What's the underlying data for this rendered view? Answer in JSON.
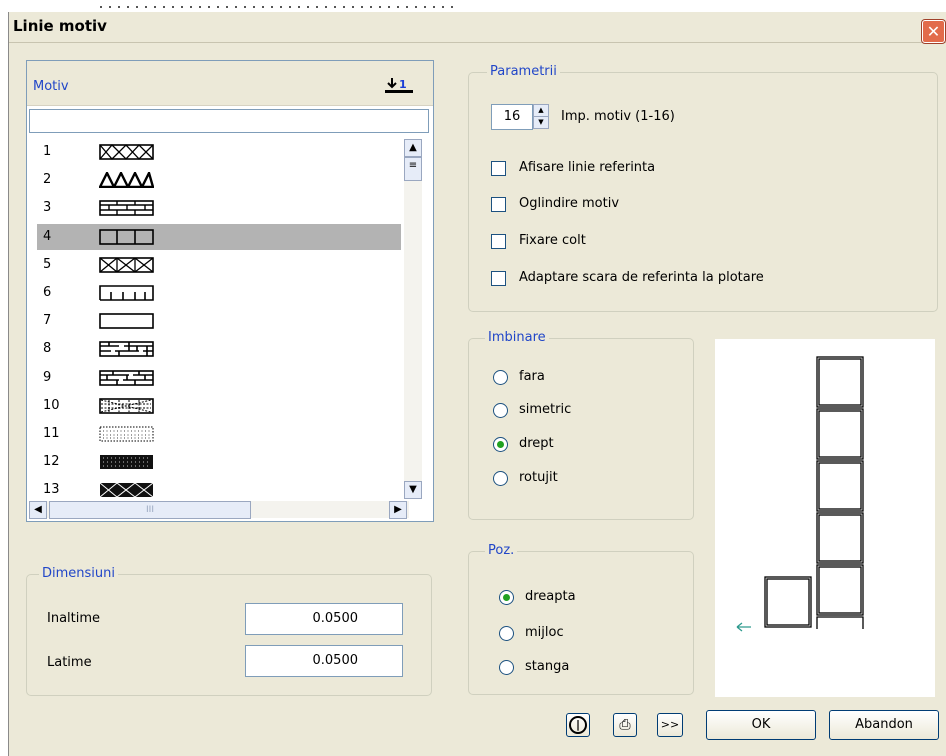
{
  "window": {
    "title": "Linie motiv",
    "close_glyph": "✕"
  },
  "motif_list": {
    "header_label": "Motiv",
    "sort_icon": "sort-1-icon",
    "filter_value": "",
    "items": [
      {
        "num": "1",
        "pattern": "cross"
      },
      {
        "num": "2",
        "pattern": "triangles"
      },
      {
        "num": "3",
        "pattern": "bricks"
      },
      {
        "num": "4",
        "pattern": "boxes",
        "selected": true
      },
      {
        "num": "5",
        "pattern": "x-boxes"
      },
      {
        "num": "6",
        "pattern": "comb"
      },
      {
        "num": "7",
        "pattern": "empty"
      },
      {
        "num": "8",
        "pattern": "maze"
      },
      {
        "num": "9",
        "pattern": "maze2"
      },
      {
        "num": "10",
        "pattern": "noise"
      },
      {
        "num": "11",
        "pattern": "dots"
      },
      {
        "num": "12",
        "pattern": "dark"
      },
      {
        "num": "13",
        "pattern": "dark-x"
      }
    ],
    "hscroll_grip": "III"
  },
  "dimensions": {
    "legend": "Dimensiuni",
    "height_label": "Inaltime",
    "height_value": "0.0500",
    "width_label": "Latime",
    "width_value": "0.0500"
  },
  "parameters": {
    "legend": "Parametrii",
    "motif_count_value": "16",
    "motif_count_label": "Imp. motiv (1-16)",
    "checkboxes": [
      {
        "label": "Afisare linie referinta",
        "checked": false
      },
      {
        "label": "Oglindire motiv",
        "checked": false
      },
      {
        "label": "Fixare colt",
        "checked": false
      },
      {
        "label": "Adaptare scara de referinta la plotare",
        "checked": false
      }
    ]
  },
  "join": {
    "legend": "Imbinare",
    "options": [
      {
        "label": "fara",
        "selected": false
      },
      {
        "label": "simetric",
        "selected": false
      },
      {
        "label": "drept",
        "selected": true
      },
      {
        "label": "rotujit",
        "selected": false
      }
    ]
  },
  "position": {
    "legend": "Poz.",
    "options": [
      {
        "label": "dreapta",
        "selected": true
      },
      {
        "label": "mijloc",
        "selected": false
      },
      {
        "label": "stanga",
        "selected": false
      }
    ]
  },
  "buttons": {
    "info_icon": "info-icon",
    "print_icon": "printer-icon",
    "more_label": ">>",
    "ok_label": "OK",
    "cancel_label": "Abandon"
  },
  "colors": {
    "accent_text": "#2146c8",
    "selection": "#b3b3b3",
    "close_button": "#e26b4b",
    "preview_arrow": "#2e9a8e"
  }
}
